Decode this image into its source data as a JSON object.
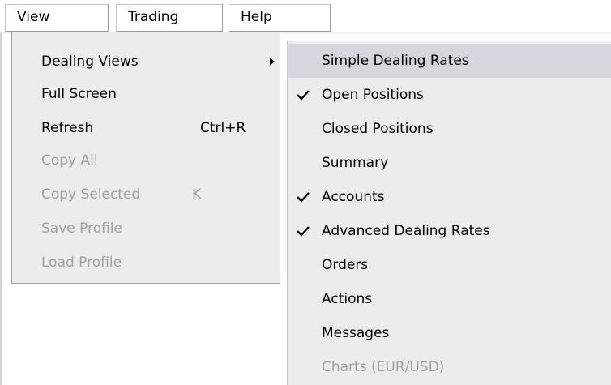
{
  "menubar": {
    "items": [
      {
        "label": "View"
      },
      {
        "label": "Trading"
      },
      {
        "label": "Help"
      }
    ]
  },
  "view_menu": {
    "items": [
      {
        "label": "Dealing Views",
        "has_submenu": true,
        "enabled": true
      },
      {
        "label": "Full Screen",
        "enabled": true
      },
      {
        "label": "Refresh",
        "shortcut": "Ctrl+R",
        "enabled": true
      },
      {
        "label": "Copy All",
        "enabled": false
      },
      {
        "label": "Copy Selected",
        "shortcut": "K",
        "enabled": false
      },
      {
        "label": "Save Profile",
        "enabled": false
      },
      {
        "label": "Load Profile",
        "enabled": false
      }
    ]
  },
  "dealing_views_submenu": {
    "items": [
      {
        "label": "Simple Dealing Rates",
        "checked": false,
        "highlighted": true,
        "enabled": true
      },
      {
        "label": "Open Positions",
        "checked": true,
        "enabled": true
      },
      {
        "label": "Closed Positions",
        "checked": false,
        "enabled": true
      },
      {
        "label": "Summary",
        "checked": false,
        "enabled": true
      },
      {
        "label": "Accounts",
        "checked": true,
        "enabled": true
      },
      {
        "label": "Advanced Dealing Rates",
        "checked": true,
        "enabled": true
      },
      {
        "label": "Orders",
        "checked": false,
        "enabled": true
      },
      {
        "label": "Actions",
        "checked": false,
        "enabled": true
      },
      {
        "label": "Messages",
        "checked": false,
        "enabled": true
      },
      {
        "label": "Charts (EUR/USD)",
        "checked": false,
        "enabled": false
      }
    ]
  },
  "icons": {
    "submenu_arrow": "triangle-right-icon",
    "check": "checkmark-icon"
  },
  "colors": {
    "menu_bg": "#ececec",
    "highlight": "#d6d6df",
    "disabled_text": "#a0a0a0"
  }
}
